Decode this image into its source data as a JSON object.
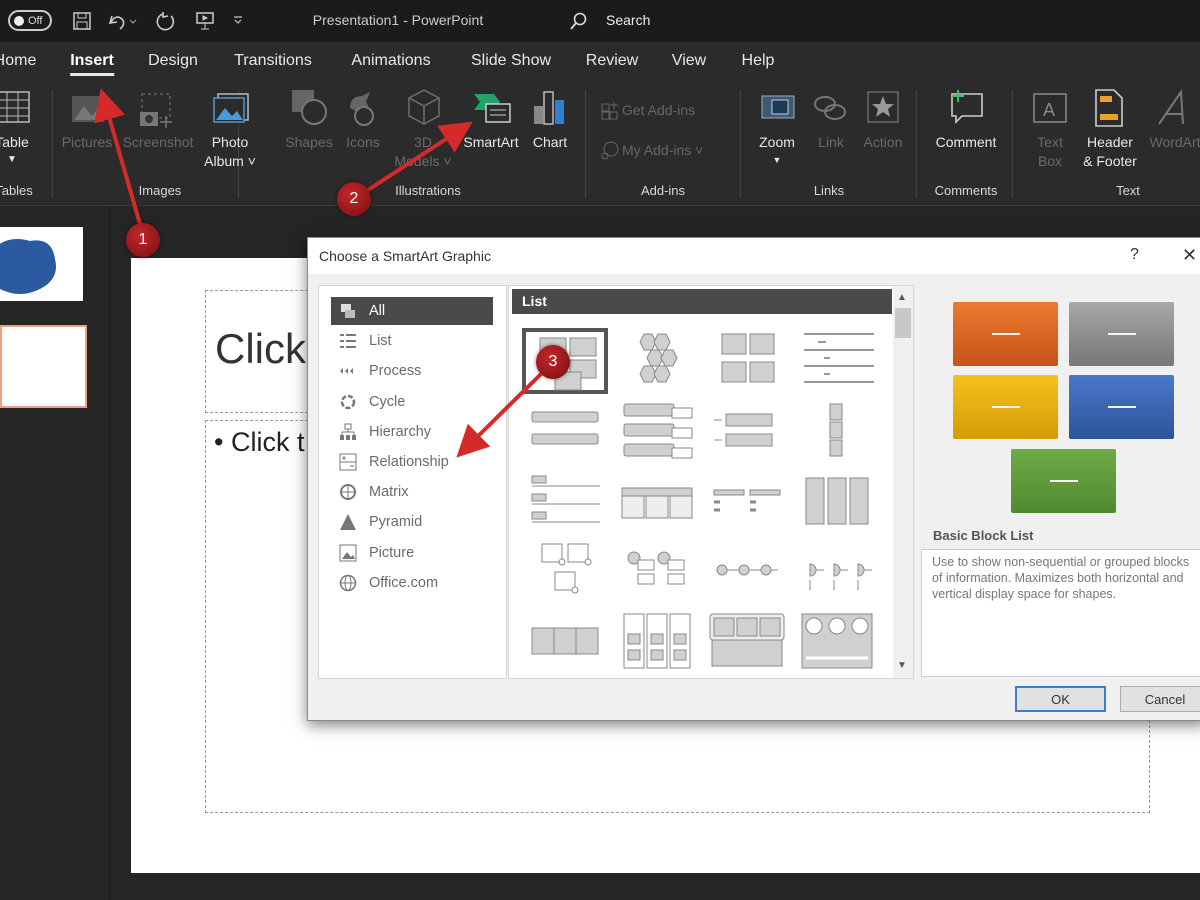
{
  "titlebar": {
    "autosave": "Off",
    "title": "Presentation1  -  PowerPoint",
    "search": "Search"
  },
  "tabs": [
    "Home",
    "Insert",
    "Design",
    "Transitions",
    "Animations",
    "Slide Show",
    "Review",
    "View",
    "Help"
  ],
  "ribbon": {
    "table": "Table",
    "pictures": "Pictures",
    "screenshot": "Screenshot",
    "photo_album": "Photo",
    "photo_album2": "Album ˅",
    "shapes": "Shapes",
    "icons": "Icons",
    "models": "3D",
    "models2": "Models ˅",
    "smartart": "SmartArt",
    "chart": "Chart",
    "get_addins": "Get Add-ins",
    "my_addins": "My Add-ins  ˅",
    "zoom": "Zoom",
    "link": "Link",
    "action": "Action",
    "comment": "Comment",
    "textbox": "Text",
    "textbox2": "Box",
    "header": "Header",
    "header2": "& Footer",
    "wordart": "WordArt",
    "groups": {
      "tables": "Tables",
      "images": "Images",
      "illustrations": "Illustrations",
      "addins": "Add-ins",
      "links": "Links",
      "comments": "Comments",
      "text": "Text"
    }
  },
  "slide": {
    "title_placeholder": "Click",
    "bullet": "•",
    "body_placeholder": "Click t"
  },
  "dialog": {
    "title": "Choose a SmartArt Graphic",
    "help": "?",
    "close": "✕",
    "categories": [
      "All",
      "List",
      "Process",
      "Cycle",
      "Hierarchy",
      "Relationship",
      "Matrix",
      "Pyramid",
      "Picture",
      "Office.com"
    ],
    "gallery_header": "List",
    "preview_name": "Basic Block List",
    "description": "Use to show non-sequential or grouped blocks of information. Maximizes both horizontal and vertical display space for shapes.",
    "ok": "OK",
    "cancel": "Cancel"
  },
  "annotations": [
    "1",
    "2",
    "3"
  ],
  "colors": {
    "accent_red": "#d42a2a",
    "preview_orange": "#d9621f",
    "preview_gray": "#8c8c8c",
    "preview_yellow": "#e8a90c",
    "preview_blue": "#3a64b0",
    "preview_green": "#5c9a3a",
    "smartart_green": "#21a366"
  }
}
